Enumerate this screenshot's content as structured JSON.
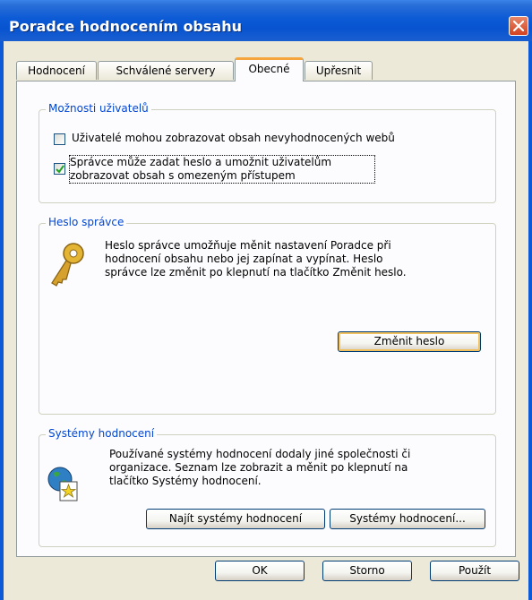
{
  "window": {
    "title": "Poradce hodnocením obsahu"
  },
  "tabs": [
    {
      "label": "Hodnocení",
      "active": false
    },
    {
      "label": "Schválené servery",
      "active": false
    },
    {
      "label": "Obecné",
      "active": true
    },
    {
      "label": "Upřesnit",
      "active": false
    }
  ],
  "user_options": {
    "legend": "Možnosti uživatelů",
    "checkbox1": {
      "label": "Uživatelé mohou zobrazovat obsah nevyhodnocených webů",
      "checked": false
    },
    "checkbox2": {
      "line1": "Správce může zadat heslo a umožnit uživatelům",
      "line2": "zobrazovat obsah s omezeným přístupem",
      "checked": true
    }
  },
  "admin_password": {
    "legend": "Heslo správce",
    "description": [
      "Heslo správce umožňuje měnit nastavení Poradce při",
      "hodnocení obsahu nebo jej zapínat a vypínat. Heslo",
      "správce lze změnit po klepnutí na tlačítko Změnit heslo."
    ],
    "change_button": "Změnit heslo",
    "icon": "key-icon"
  },
  "rating_systems": {
    "legend": "Systémy hodnocení",
    "description": [
      "Používané systémy hodnocení dodaly jiné společnosti či",
      "organizace. Seznam lze zobrazit a měnit po klepnutí na",
      "tlačítko Systémy hodnocení."
    ],
    "find_button": "Najít systémy hodnocení",
    "systems_button": "Systémy hodnocení...",
    "icon": "globe-star-icon"
  },
  "footer": {
    "ok": "OK",
    "cancel": "Storno",
    "apply": "Použít"
  },
  "colors": {
    "title_bar": "#0c5ad5",
    "legend_text": "#0046d5",
    "active_tab_accent": "#f5a53b",
    "close_button": "#d3411e"
  }
}
